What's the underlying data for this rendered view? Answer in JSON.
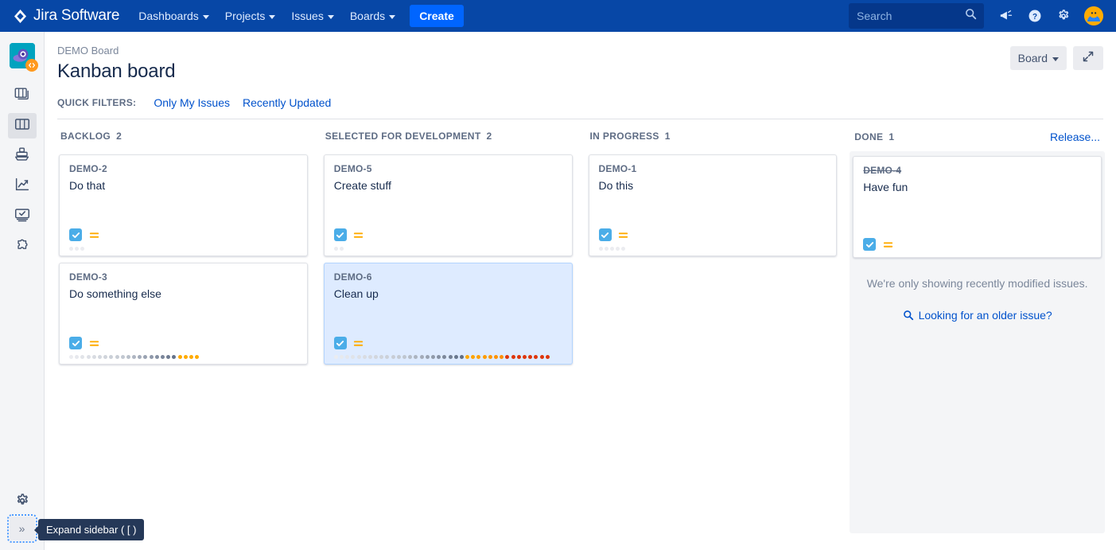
{
  "topnav": {
    "logo_text": "Jira Software",
    "logo_icon": "jira-diamond-logo",
    "items": [
      {
        "label": "Dashboards",
        "icon": "chevron-down-icon"
      },
      {
        "label": "Projects",
        "icon": "chevron-down-icon"
      },
      {
        "label": "Issues",
        "icon": "chevron-down-icon"
      },
      {
        "label": "Boards",
        "icon": "chevron-down-icon"
      }
    ],
    "create_label": "Create",
    "search": {
      "placeholder": "Search",
      "value": "",
      "icon": "search-icon"
    },
    "right_icons": [
      {
        "name": "announcements-icon"
      },
      {
        "name": "help-icon"
      },
      {
        "name": "settings-gear-icon"
      }
    ],
    "avatar": {
      "name": "user-avatar"
    },
    "bg_color": "#0747A6",
    "create_color": "#0065FF"
  },
  "sidebar": {
    "project_avatar": {
      "name": "project-avatar-rocket",
      "bg": "#00A3BF",
      "badge": "#FF991F"
    },
    "items": [
      {
        "name": "backlog",
        "icon": "backlog-icon",
        "active": false
      },
      {
        "name": "board",
        "icon": "board-columns-icon",
        "active": true
      },
      {
        "name": "releases",
        "icon": "ship-releases-icon",
        "active": false
      },
      {
        "name": "reports",
        "icon": "reports-chart-icon",
        "active": false
      },
      {
        "name": "issues",
        "icon": "issues-monitor-icon",
        "active": false
      },
      {
        "name": "add-ons",
        "icon": "puzzle-addons-icon",
        "active": false
      }
    ],
    "settings_icon": "project-settings-gear-icon",
    "expand_icon": "»",
    "tooltip": "Expand sidebar ( [ )"
  },
  "header": {
    "breadcrumb": "DEMO Board",
    "title": "Kanban board",
    "board_select_label": "Board",
    "fullscreen_icon": "expand-fullscreen-icon"
  },
  "quick_filters": {
    "label": "QUICK FILTERS:",
    "items": [
      {
        "label": "Only My Issues"
      },
      {
        "label": "Recently Updated"
      }
    ]
  },
  "board": {
    "columns": [
      {
        "name": "BACKLOG",
        "count": "2",
        "release_link": null,
        "tinted": false,
        "cards": [
          {
            "key": "DEMO-2",
            "summary": "Do that",
            "done": false,
            "selected": false,
            "type_icon": "task-checkbox-icon",
            "priority_icon": "priority-medium-icon",
            "days_dots": 3,
            "dot_profile": "short"
          },
          {
            "key": "DEMO-3",
            "summary": "Do something else",
            "done": false,
            "selected": false,
            "type_icon": "task-checkbox-icon",
            "priority_icon": "priority-medium-icon",
            "days_dots": 23,
            "dot_profile": "amber"
          }
        ],
        "message": null,
        "link": null
      },
      {
        "name": "SELECTED FOR DEVELOPMENT",
        "count": "2",
        "release_link": null,
        "tinted": false,
        "cards": [
          {
            "key": "DEMO-5",
            "summary": "Create stuff",
            "done": false,
            "selected": false,
            "type_icon": "task-checkbox-icon",
            "priority_icon": "priority-medium-icon",
            "days_dots": 2,
            "dot_profile": "short"
          },
          {
            "key": "DEMO-6",
            "summary": "Clean up",
            "done": false,
            "selected": true,
            "type_icon": "task-checkbox-icon",
            "priority_icon": "priority-medium-icon",
            "days_dots": 38,
            "dot_profile": "red"
          }
        ],
        "message": null,
        "link": null
      },
      {
        "name": "IN PROGRESS",
        "count": "1",
        "release_link": null,
        "tinted": false,
        "cards": [
          {
            "key": "DEMO-1",
            "summary": "Do this",
            "done": false,
            "selected": false,
            "type_icon": "task-checkbox-icon",
            "priority_icon": "priority-medium-icon",
            "days_dots": 5,
            "dot_profile": "short"
          }
        ],
        "message": null,
        "link": null
      },
      {
        "name": "DONE",
        "count": "1",
        "release_link": "Release...",
        "tinted": true,
        "cards": [
          {
            "key": "DEMO-4",
            "summary": "Have fun",
            "done": true,
            "selected": false,
            "type_icon": "task-checkbox-icon",
            "priority_icon": "priority-medium-icon",
            "days_dots": 0,
            "dot_profile": "none"
          }
        ],
        "message": "We're only showing recently modified issues.",
        "link": {
          "label": "Looking for an older issue?",
          "icon": "search-icon"
        }
      }
    ]
  },
  "colors": {
    "nav_bg": "#0747A6",
    "accent_blue": "#0052CC",
    "card_selected_bg": "#DEEBFF",
    "priority_amber": "#FFAB00",
    "type_blue": "#4BADE8",
    "column_tint": "#F4F5F7"
  }
}
